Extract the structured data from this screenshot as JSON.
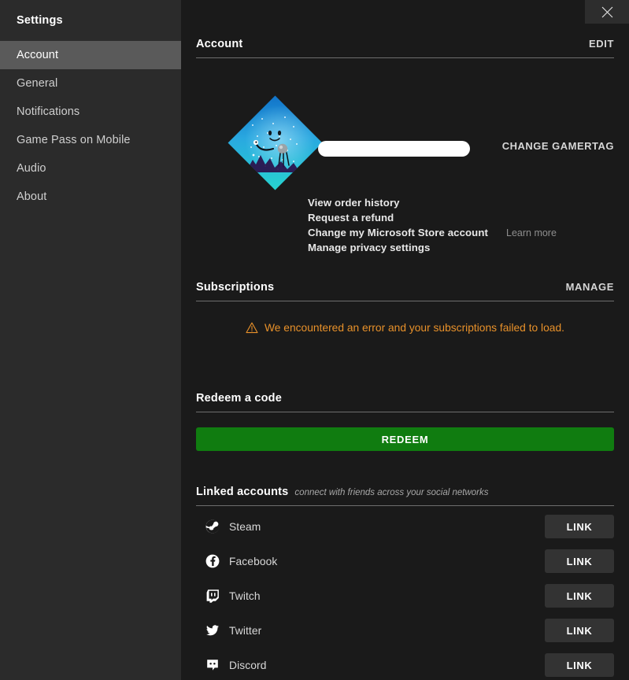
{
  "window": {
    "close_icon": "close-icon"
  },
  "sidebar": {
    "title": "Settings",
    "items": [
      {
        "label": "Account",
        "selected": true
      },
      {
        "label": "General",
        "selected": false
      },
      {
        "label": "Notifications",
        "selected": false
      },
      {
        "label": "Game Pass on Mobile",
        "selected": false
      },
      {
        "label": "Audio",
        "selected": false
      },
      {
        "label": "About",
        "selected": false
      }
    ]
  },
  "account": {
    "title": "Account",
    "action": "EDIT",
    "avatar_alt": "avatar",
    "gamertag_value": "",
    "change_gamertag": "CHANGE GAMERTAG",
    "links": [
      {
        "label": "View order history",
        "note": ""
      },
      {
        "label": "Request a refund",
        "note": ""
      },
      {
        "label": "Change my Microsoft Store account",
        "note": "Learn more"
      },
      {
        "label": "Manage privacy settings",
        "note": ""
      }
    ]
  },
  "subscriptions": {
    "title": "Subscriptions",
    "action": "MANAGE",
    "error_icon": "warning-triangle-icon",
    "error_message": "We encountered an error and your subscriptions failed to load.",
    "error_color": "#e8912a"
  },
  "redeem": {
    "title": "Redeem a code",
    "button_label": "REDEEM",
    "button_color": "#107c10"
  },
  "linked_accounts": {
    "title": "Linked accounts",
    "subtitle": "connect with friends across your social networks",
    "rows": [
      {
        "name": "Steam",
        "icon": "steam-icon",
        "action": "LINK"
      },
      {
        "name": "Facebook",
        "icon": "facebook-icon",
        "action": "LINK"
      },
      {
        "name": "Twitch",
        "icon": "twitch-icon",
        "action": "LINK"
      },
      {
        "name": "Twitter",
        "icon": "twitter-icon",
        "action": "LINK"
      },
      {
        "name": "Discord",
        "icon": "discord-icon",
        "action": "LINK"
      }
    ]
  }
}
